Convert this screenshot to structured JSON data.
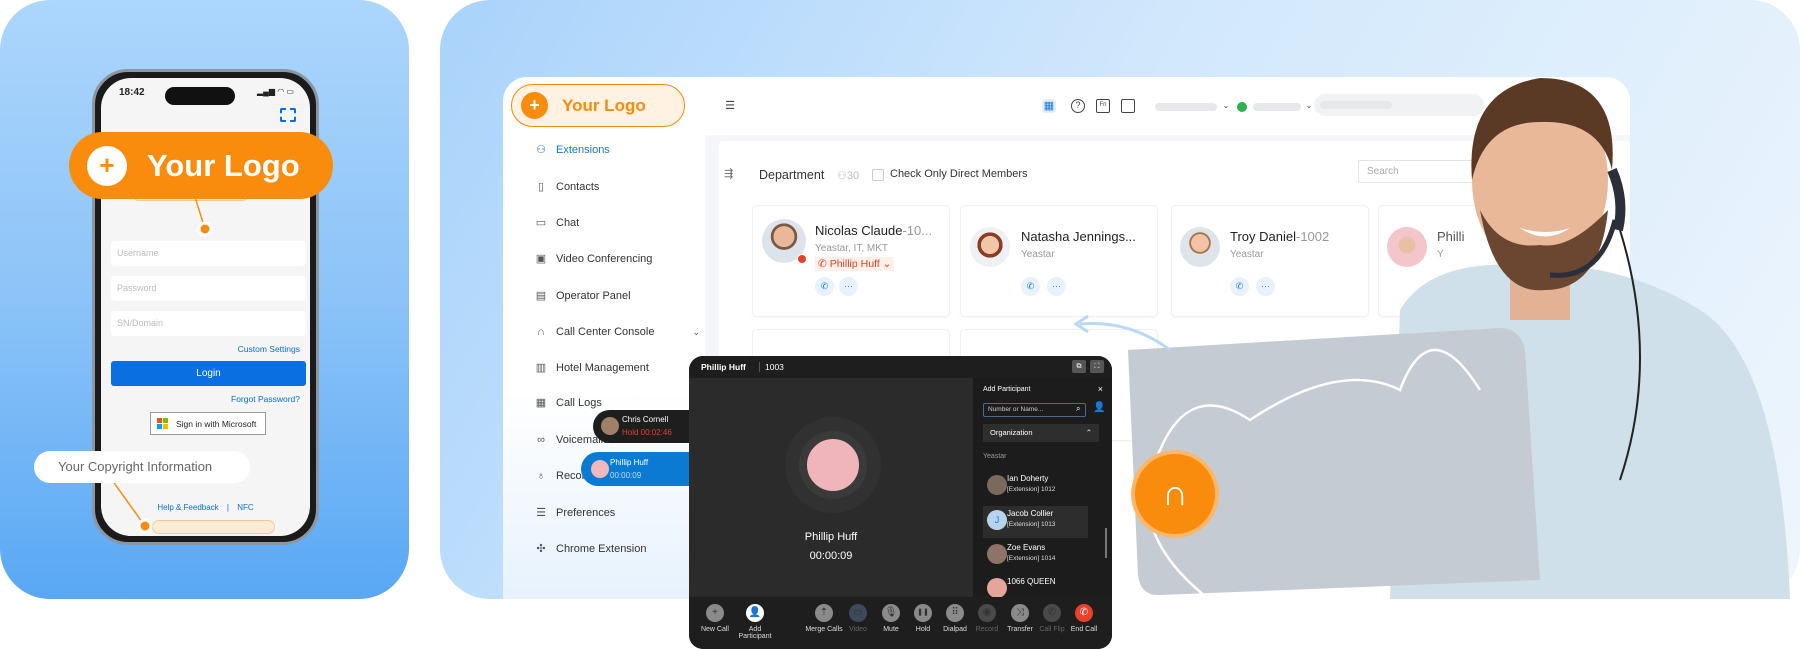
{
  "mobile": {
    "status_time": "18:42",
    "logo_label": "Your Logo",
    "username_placeholder": "Username",
    "password_placeholder": "Password",
    "domain_placeholder": "SN/Domain",
    "custom_settings": "Custom Settings",
    "login": "Login",
    "forgot_password": "Forgot Password?",
    "microsoft_signin": "Sign in with Microsoft",
    "copyright_label": "Your Copyright Information",
    "help_feedback": "Help & Feedback",
    "separator": "|",
    "nfc": "NFC"
  },
  "desktop": {
    "logo_label": "Your Logo",
    "sidebar": {
      "items": [
        {
          "label": "Extensions",
          "icon": "extensions-icon",
          "active": true
        },
        {
          "label": "Contacts",
          "icon": "contacts-icon"
        },
        {
          "label": "Chat",
          "icon": "chat-icon"
        },
        {
          "label": "Video Conferencing",
          "icon": "video-conferencing-icon"
        },
        {
          "label": "Operator Panel",
          "icon": "operator-panel-icon"
        },
        {
          "label": "Call Center Console",
          "icon": "headset-icon",
          "expandable": true
        },
        {
          "label": "Hotel Management",
          "icon": "hotel-icon",
          "expandable": true
        },
        {
          "label": "Call Logs",
          "icon": "call-logs-icon"
        },
        {
          "label": "Voicemails",
          "icon": "voicemail-icon"
        },
        {
          "label": "Recordings",
          "icon": "microphone-icon"
        },
        {
          "label": "Preferences",
          "icon": "preferences-icon"
        },
        {
          "label": "Chrome Extension",
          "icon": "puzzle-icon"
        }
      ]
    },
    "department": {
      "title": "Department",
      "member_count": "30",
      "direct_members_label": "Check Only Direct Members",
      "search_placeholder": "Search"
    },
    "extensions": [
      {
        "name": "Nicolas Claude",
        "ext": "-10...",
        "dept": "Yeastar, IT, MKT",
        "in_call_with": "Phillip Huff",
        "status_color": "#e5402a"
      },
      {
        "name": "Natasha Jennings...",
        "ext": "",
        "dept": "Yeastar"
      },
      {
        "name": "Troy Daniel",
        "ext": "-1002",
        "dept": "Yeastar"
      },
      {
        "name": "Philli",
        "ext": "",
        "dept": "Y"
      }
    ],
    "call_pills": [
      {
        "name": "Chris Cornell",
        "status": "Hold 00:02:46"
      },
      {
        "name": "Phillip Huff",
        "status": "00:00:09"
      }
    ]
  },
  "call_window": {
    "caller_name": "Phillip Huff",
    "caller_ext": "1003",
    "timer": "00:00:09",
    "panel": {
      "title": "Add Participant",
      "close": "×",
      "search_placeholder": "Number or Name...",
      "group_label": "Organization",
      "org_name": "Yeastar",
      "participants": [
        {
          "name": "Ian Doherty",
          "detail": "[Extension] 1012"
        },
        {
          "name": "Jacob Collier",
          "detail": "[Extension] 1013",
          "initial": "J",
          "selected": true
        },
        {
          "name": "Zoe Evans",
          "detail": "[Extension] 1014"
        },
        {
          "name": "1066 QUEEN",
          "detail": ""
        }
      ]
    },
    "controls": [
      {
        "label": "New Call",
        "glyph": "+",
        "enabled": true
      },
      {
        "label": "Add Participant",
        "glyph": "👤",
        "enabled": true
      },
      {
        "label": "Merge Calls",
        "glyph": "⇡",
        "enabled": true
      },
      {
        "label": "Video",
        "glyph": "▭",
        "enabled": false
      },
      {
        "label": "Mute",
        "glyph": "🎙",
        "enabled": true
      },
      {
        "label": "Hold",
        "glyph": "❚❚",
        "enabled": true
      },
      {
        "label": "Dialpad",
        "glyph": "⠿",
        "enabled": true
      },
      {
        "label": "Record",
        "glyph": "◉",
        "enabled": false
      },
      {
        "label": "Transfer",
        "glyph": "⤨",
        "enabled": true
      },
      {
        "label": "Call Flip",
        "glyph": "✆",
        "enabled": false
      },
      {
        "label": "End Call",
        "glyph": "✆",
        "enabled": true
      }
    ]
  },
  "colors": {
    "brand_orange": "#f98c0d",
    "primary_blue": "#0a6fe0",
    "end_call_red": "#e8412c",
    "online_green": "#2bb24c"
  }
}
